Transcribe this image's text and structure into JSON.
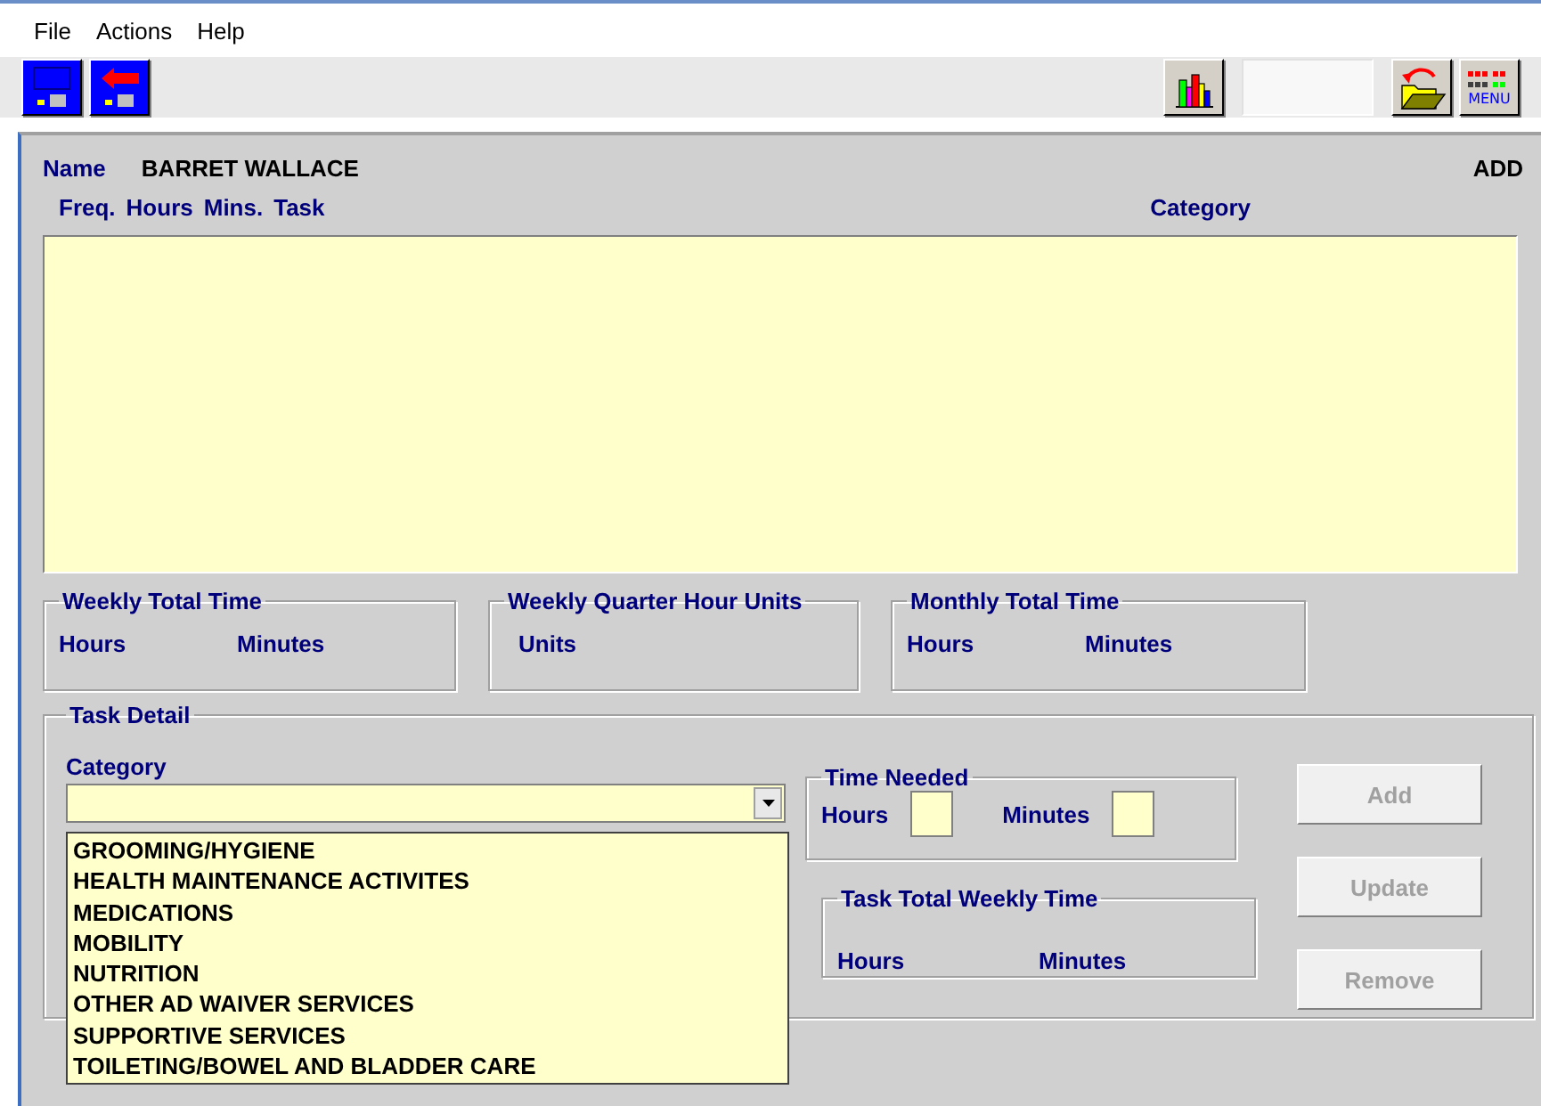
{
  "menu": [
    "File",
    "Actions",
    "Help"
  ],
  "toolbar": {
    "left": [
      {
        "kind": "save"
      },
      {
        "kind": "exit"
      }
    ],
    "right": [
      {
        "kind": "chart"
      },
      {
        "kind": "spacer"
      },
      {
        "kind": "open"
      },
      {
        "kind": "menu",
        "label": "MENU"
      }
    ]
  },
  "header": {
    "name_label": "Name",
    "name_value": "BARRET WALLACE",
    "mode": "ADD"
  },
  "task_columns": [
    "Freq.",
    "Hours",
    "Mins.",
    "Task",
    "Category"
  ],
  "totals": [
    {
      "title": "Weekly Total Time",
      "labels": [
        "Hours",
        "Minutes"
      ]
    },
    {
      "title": "Weekly Quarter Hour Units",
      "labels": [
        "Units"
      ]
    },
    {
      "title": "Monthly Total Time",
      "labels": [
        "Hours",
        "Minutes"
      ]
    }
  ],
  "task_detail": {
    "title": "Task Detail",
    "category_label": "Category",
    "category_dropdown": {
      "expanded": true,
      "options": [
        "GROOMING/HYGIENE",
        "HEALTH MAINTENANCE ACTIVITES",
        "MEDICATIONS",
        "MOBILITY",
        "NUTRITION",
        "OTHER AD WAIVER SERVICES",
        "SUPPORTIVE SERVICES",
        "TOILETING/BOWEL AND BLADDER CARE"
      ]
    },
    "time_needed": {
      "title": "Time Needed",
      "hours_label": "Hours",
      "minutes_label": "Minutes"
    },
    "task_total": {
      "title": "Task Total Weekly Time",
      "labels": [
        "Hours",
        "Minutes"
      ]
    },
    "buttons": [
      {
        "label": "Add",
        "disabled": true
      },
      {
        "label": "Update",
        "disabled": true
      },
      {
        "label": "Remove",
        "disabled": true
      }
    ]
  }
}
